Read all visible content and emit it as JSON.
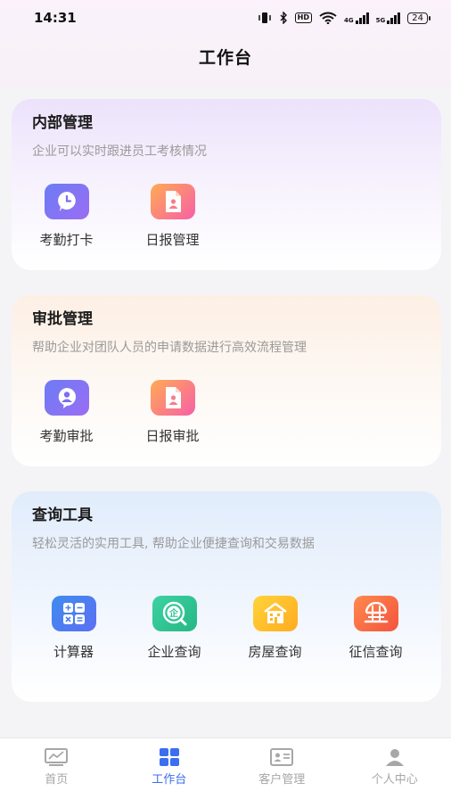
{
  "status_bar": {
    "time": "14:31",
    "icons": [
      "vibrate-icon",
      "bluetooth-icon",
      "hd-icon",
      "wifi-icon",
      "4g-signal-icon",
      "5g-signal-icon",
      "battery-icon"
    ],
    "hd_label": "HD",
    "signal_4g": "4G",
    "signal_5g": "5G",
    "battery_level": "24"
  },
  "header": {
    "title": "工作台"
  },
  "sections": [
    {
      "title": "内部管理",
      "description": "企业可以实时跟进员工考核情况",
      "items": [
        {
          "label": "考勤打卡",
          "icon": "clock-bubble-icon",
          "color": "#7a74f4"
        },
        {
          "label": "日报管理",
          "icon": "report-document-icon",
          "color": "#fb7f8a"
        }
      ]
    },
    {
      "title": "审批管理",
      "description": "帮助企业对团队人员的申请数据进行高效流程管理",
      "items": [
        {
          "label": "考勤审批",
          "icon": "user-bubble-icon",
          "color": "#7a74f4"
        },
        {
          "label": "日报审批",
          "icon": "report-document-icon",
          "color": "#fb7f8a"
        }
      ]
    },
    {
      "title": "查询工具",
      "description": "轻松灵活的实用工具, 帮助企业便捷查询和交易数据",
      "items": [
        {
          "label": "计算器",
          "icon": "calculator-icon",
          "color": "#4a7ff0"
        },
        {
          "label": "企业查询",
          "icon": "enterprise-search-icon",
          "color": "#30c493",
          "glyph": "企"
        },
        {
          "label": "房屋查询",
          "icon": "house-search-icon",
          "color": "#ffbf2c"
        },
        {
          "label": "征信查询",
          "icon": "credit-globe-icon",
          "color": "#f96c45"
        }
      ]
    }
  ],
  "tabbar": {
    "active_index": 1,
    "active_color": "#3b6ef0",
    "inactive_color": "#a7a7a7",
    "tabs": [
      {
        "label": "首页",
        "icon": "chart-home-icon"
      },
      {
        "label": "工作台",
        "icon": "grid-apps-icon"
      },
      {
        "label": "客户管理",
        "icon": "id-card-icon"
      },
      {
        "label": "个人中心",
        "icon": "person-icon"
      }
    ]
  }
}
